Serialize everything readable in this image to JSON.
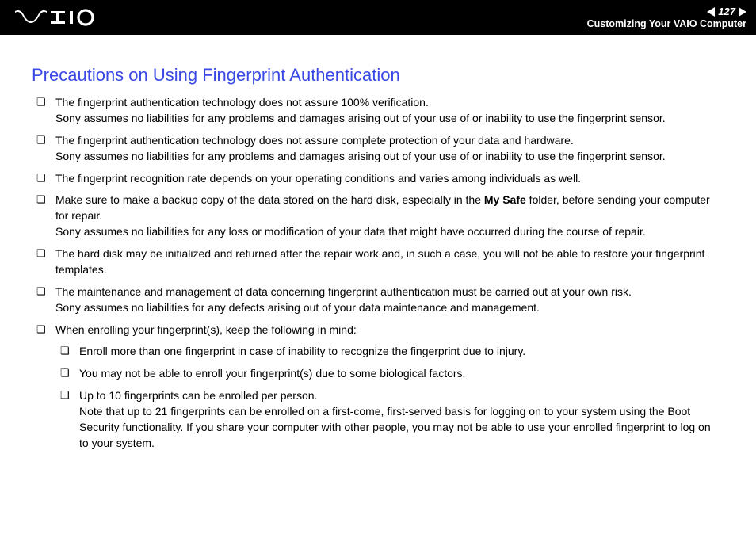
{
  "header": {
    "page_number": "127",
    "section_title": "Customizing Your VAIO Computer"
  },
  "heading": "Precautions on Using Fingerprint Authentication",
  "bullets": [
    {
      "lines": [
        "The fingerprint authentication technology does not assure 100% verification.",
        "Sony assumes no liabilities for any problems and damages arising out of your use of or inability to use the fingerprint sensor."
      ]
    },
    {
      "lines": [
        "The fingerprint authentication technology does not assure complete protection of your data and hardware.",
        "Sony assumes no liabilities for any problems and damages arising out of your use of or inability to use the fingerprint sensor."
      ]
    },
    {
      "lines": [
        "The fingerprint recognition rate depends on your operating conditions and varies among individuals as well."
      ]
    },
    {
      "pre": "Make sure to make a backup copy of the data stored on the hard disk, especially in the ",
      "bold": "My Safe",
      "post": " folder, before sending your computer for repair.",
      "lines2": [
        "Sony assumes no liabilities for any loss or modification of your data that might have occurred during the course of repair."
      ]
    },
    {
      "lines": [
        "The hard disk may be initialized and returned after the repair work and, in such a case, you will not be able to restore your fingerprint templates."
      ]
    },
    {
      "lines": [
        "The maintenance and management of data concerning fingerprint authentication must be carried out at your own risk.",
        "Sony assumes no liabilities for any defects arising out of your data maintenance and management."
      ]
    },
    {
      "lines": [
        "When enrolling your fingerprint(s), keep the following in mind:"
      ],
      "sub": [
        {
          "lines": [
            "Enroll more than one fingerprint in case of inability to recognize the fingerprint due to injury."
          ]
        },
        {
          "lines": [
            "You may not be able to enroll your fingerprint(s) due to some biological factors."
          ]
        },
        {
          "lines": [
            "Up to 10 fingerprints can be enrolled per person.",
            "Note that up to 21 fingerprints can be enrolled on a first-come, first-served basis for logging on to your system using the Boot Security functionality. If you share your computer with other people, you may not be able to use your enrolled fingerprint to log on to your system."
          ]
        }
      ]
    }
  ]
}
